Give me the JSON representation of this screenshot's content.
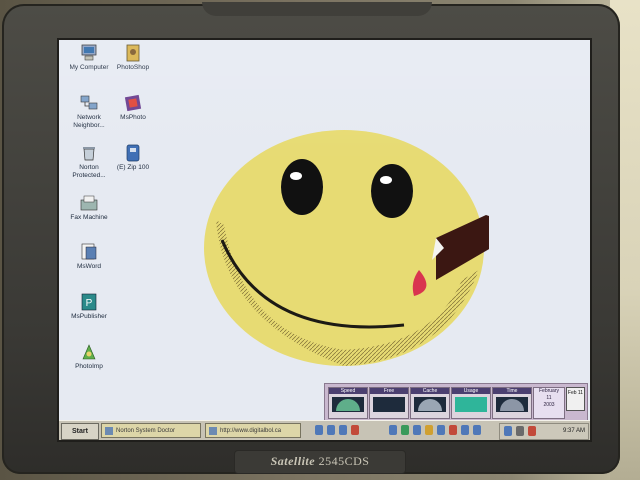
{
  "monitor": {
    "brand_model": "Satellite",
    "brand_number": "2545CDS"
  },
  "desktop": {
    "icons": [
      {
        "name": "my-computer",
        "label": "My Computer",
        "icon": "computer-icon"
      },
      {
        "name": "photoshop",
        "label": "PhotoShop",
        "icon": "photoshop-icon"
      },
      {
        "name": "network-neighborhood",
        "label": "Network Neighbor...",
        "icon": "network-icon"
      },
      {
        "name": "msphoto",
        "label": "MsPhoto",
        "icon": "photo-icon"
      },
      {
        "name": "norton-protected",
        "label": "Norton Protected...",
        "icon": "recycle-icon"
      },
      {
        "name": "zip",
        "label": "(E) Zip 100",
        "icon": "zip-drive-icon"
      },
      {
        "name": "fax-machine",
        "label": "Fax Machine",
        "icon": "fax-icon"
      },
      {
        "name": "msword",
        "label": "MsWord",
        "icon": "word-icon"
      },
      {
        "name": "mspublisher",
        "label": "MsPublisher",
        "icon": "publisher-icon"
      },
      {
        "name": "photoimp",
        "label": "PhotoImp",
        "icon": "photoimp-icon"
      }
    ]
  },
  "tray_panel": {
    "gauges": [
      {
        "title": "Speed",
        "status": ""
      },
      {
        "title": "Free",
        "status": ""
      },
      {
        "title": "Cache",
        "status": ""
      },
      {
        "title": "Usage",
        "status": ""
      },
      {
        "title": "Time",
        "status": ""
      }
    ],
    "calendar": {
      "month": "February",
      "day": "11",
      "year": "2003"
    },
    "calendar_label": "Feb 11"
  },
  "taskbar": {
    "start_label": "Start",
    "tasks": [
      {
        "label": "Norton System Doctor"
      },
      {
        "label": "http://www.digitalbol.ca"
      }
    ],
    "clock": "9:37 AM"
  },
  "colors": {
    "desktop_bg": "#e6eaf2",
    "smiley_face": "#e7db73",
    "taskbar": "#c7c3b5"
  }
}
